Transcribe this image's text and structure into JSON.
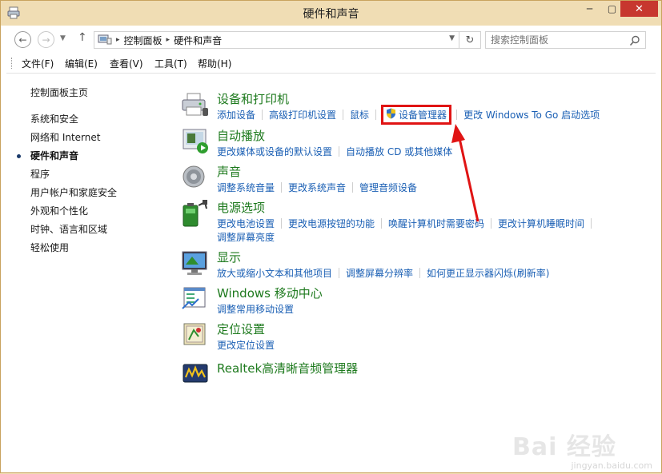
{
  "window": {
    "title": "硬件和声音",
    "controls": {
      "minimize": "─",
      "maximize": "▢",
      "close": "✕"
    }
  },
  "address": {
    "crumbs": [
      "控制面板",
      "硬件和声音"
    ],
    "separator": "▸",
    "search_placeholder": "搜索控制面板"
  },
  "menu": [
    "文件(F)",
    "编辑(E)",
    "查看(V)",
    "工具(T)",
    "帮助(H)"
  ],
  "sidebar": {
    "items": [
      {
        "label": "控制面板主页"
      },
      {
        "label": "系统和安全"
      },
      {
        "label": "网络和 Internet"
      },
      {
        "label": "硬件和声音",
        "active": true
      },
      {
        "label": "程序"
      },
      {
        "label": "用户帐户和家庭安全"
      },
      {
        "label": "外观和个性化"
      },
      {
        "label": "时钟、语言和区域"
      },
      {
        "label": "轻松使用"
      }
    ]
  },
  "categories": [
    {
      "title": "设备和打印机",
      "icon": "printer-icon",
      "links": [
        "添加设备",
        "高级打印机设置",
        "鼠标",
        "设备管理器",
        "更改 Windows To Go 启动选项"
      ],
      "highlighted_link": "设备管理器"
    },
    {
      "title": "自动播放",
      "icon": "autoplay-icon",
      "links": [
        "更改媒体或设备的默认设置",
        "自动播放 CD 或其他媒体"
      ]
    },
    {
      "title": "声音",
      "icon": "speaker-icon",
      "links": [
        "调整系统音量",
        "更改系统声音",
        "管理音频设备"
      ]
    },
    {
      "title": "电源选项",
      "icon": "battery-icon",
      "links": [
        "更改电池设置",
        "更改电源按钮的功能",
        "唤醒计算机时需要密码",
        "更改计算机睡眠时间"
      ],
      "links_row2": [
        "调整屏幕亮度"
      ]
    },
    {
      "title": "显示",
      "icon": "monitor-icon",
      "links": [
        "放大或缩小文本和其他项目",
        "调整屏幕分辨率",
        "如何更正显示器闪烁(刷新率)"
      ]
    },
    {
      "title": "Windows 移动中心",
      "icon": "mobility-center-icon",
      "links": [
        "调整常用移动设置"
      ]
    },
    {
      "title": "定位设置",
      "icon": "location-icon",
      "links": [
        "更改定位设置"
      ]
    },
    {
      "title": "Realtek高清晰音频管理器",
      "icon": "realtek-icon",
      "links": []
    }
  ],
  "watermark": {
    "brand": "Bai 经验",
    "url": "jingyan.baidu.com"
  },
  "colors": {
    "titlebar": "#f0ddb4",
    "category_title": "#1e7a1e",
    "link": "#1a5fb4",
    "highlight": "#e01414",
    "close_button": "#c7372f"
  }
}
